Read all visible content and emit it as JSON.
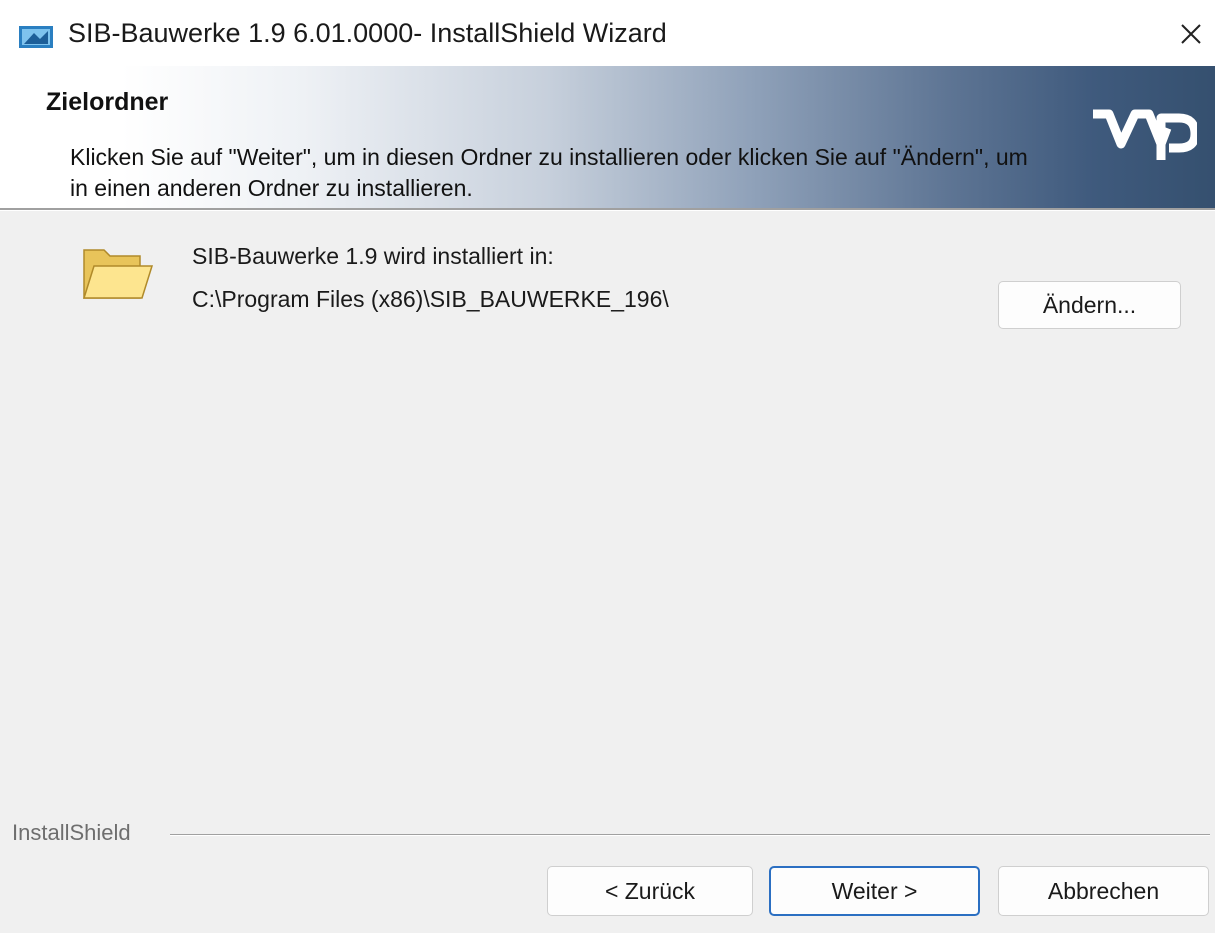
{
  "window": {
    "title": "SIB-Bauwerke 1.9 6.01.0000- InstallShield Wizard",
    "close_icon": "close-icon",
    "app_icon": "installer-app-icon"
  },
  "banner": {
    "title": "Zielordner",
    "description": "Klicken Sie auf \"Weiter\", um in diesen Ordner zu installieren oder klicken Sie auf \"Ändern\", um in einen anderen Ordner zu installieren.",
    "logo": "wap-logo"
  },
  "content": {
    "folder_icon": "folder-icon",
    "install_label": "SIB-Bauwerke 1.9 wird installiert in:",
    "install_path": "C:\\Program Files (x86)\\SIB_BAUWERKE_196\\",
    "change_button": "Ändern..."
  },
  "footer": {
    "brand": "InstallShield",
    "back_button": "< Zurück",
    "next_button": "Weiter >",
    "cancel_button": "Abbrechen"
  },
  "colors": {
    "banner_dark": "#35506f",
    "focus_border": "#2b6fc2",
    "dialog_background": "#f0f0f0"
  }
}
